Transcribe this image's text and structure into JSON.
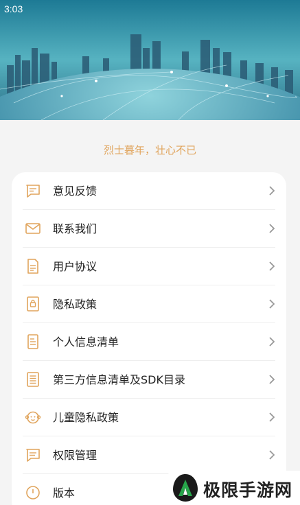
{
  "status_bar": {
    "time": "3:03"
  },
  "slogan": "烈士暮年，壮心不已",
  "menu": [
    {
      "label": "意见反馈",
      "icon": "feedback-icon"
    },
    {
      "label": "联系我们",
      "icon": "mail-icon"
    },
    {
      "label": "用户协议",
      "icon": "document-icon"
    },
    {
      "label": "隐私政策",
      "icon": "privacy-lock-icon"
    },
    {
      "label": "个人信息清单",
      "icon": "list-icon"
    },
    {
      "label": "第三方信息清单及SDK目录",
      "icon": "catalog-icon"
    },
    {
      "label": "儿童隐私政策",
      "icon": "child-face-icon"
    },
    {
      "label": "权限管理",
      "icon": "permission-icon"
    },
    {
      "label": "版本",
      "icon": "info-icon"
    }
  ],
  "watermark": {
    "text": "极限手游网",
    "icon": "brand-logo-icon"
  },
  "colors": {
    "accent": "#e0a45c",
    "background": "#f4f4f4",
    "card": "#ffffff"
  }
}
